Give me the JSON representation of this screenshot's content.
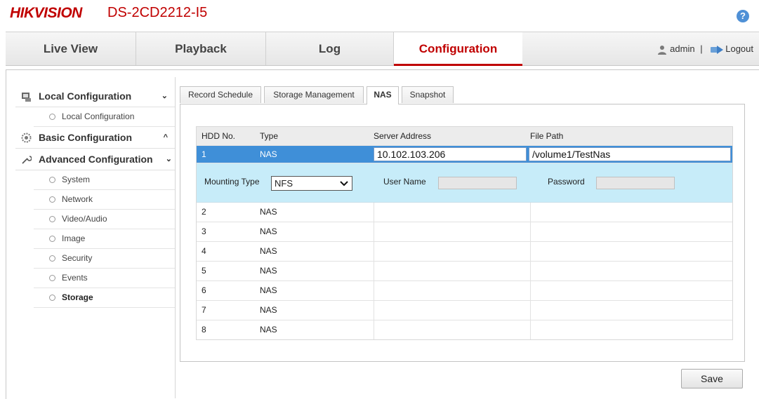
{
  "header": {
    "brand": "HIKVISION",
    "model": "DS-2CD2212-I5",
    "help_label": "?"
  },
  "nav": {
    "tabs": [
      {
        "label": "Live View"
      },
      {
        "label": "Playback"
      },
      {
        "label": "Log"
      },
      {
        "label": "Configuration",
        "active": true
      }
    ],
    "user": "admin",
    "separator": "|",
    "logout": "Logout"
  },
  "sidebar": {
    "sections": [
      {
        "label": "Local Configuration",
        "chevron": "⌄",
        "items": [
          {
            "label": "Local Configuration"
          }
        ]
      },
      {
        "label": "Basic Configuration",
        "chevron": "^",
        "items": []
      },
      {
        "label": "Advanced Configuration",
        "chevron": "⌄",
        "items": [
          {
            "label": "System"
          },
          {
            "label": "Network"
          },
          {
            "label": "Video/Audio"
          },
          {
            "label": "Image"
          },
          {
            "label": "Security"
          },
          {
            "label": "Events"
          },
          {
            "label": "Storage",
            "active": true
          }
        ]
      }
    ]
  },
  "subtabs": [
    {
      "label": "Record Schedule"
    },
    {
      "label": "Storage Management"
    },
    {
      "label": "NAS",
      "active": true
    },
    {
      "label": "Snapshot"
    }
  ],
  "table": {
    "columns": [
      "HDD No.",
      "Type",
      "Server Address",
      "File Path"
    ],
    "selected_row": {
      "hdd": "1",
      "type": "NAS",
      "server_address": "10.102.103.206",
      "file_path": "/volume1/TestNas"
    },
    "detail": {
      "mounting_type_label": "Mounting Type",
      "mounting_type_value": "NFS",
      "user_name_label": "User Name",
      "password_label": "Password"
    },
    "rows": [
      {
        "hdd": "2",
        "type": "NAS"
      },
      {
        "hdd": "3",
        "type": "NAS"
      },
      {
        "hdd": "4",
        "type": "NAS"
      },
      {
        "hdd": "5",
        "type": "NAS"
      },
      {
        "hdd": "6",
        "type": "NAS"
      },
      {
        "hdd": "7",
        "type": "NAS"
      },
      {
        "hdd": "8",
        "type": "NAS"
      }
    ]
  },
  "save_label": "Save",
  "colors": {
    "brand": "#c00000",
    "selected_row": "#3f8fd8",
    "detail_bg": "#c7ecf9"
  }
}
